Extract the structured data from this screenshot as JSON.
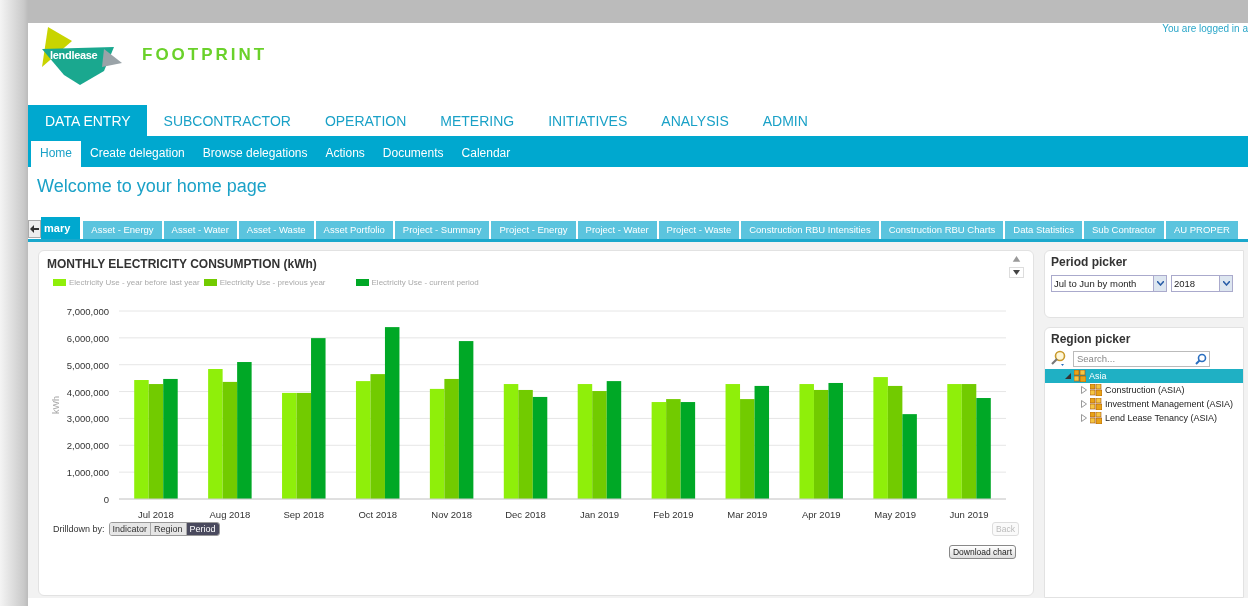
{
  "header": {
    "logo_text": "lendlease",
    "product": "FOOTPRINT",
    "login_text": "You are logged in a"
  },
  "main_nav": [
    {
      "label": "DATA ENTRY",
      "selected": true
    },
    {
      "label": "SUBCONTRACTOR",
      "selected": false
    },
    {
      "label": "OPERATION",
      "selected": false
    },
    {
      "label": "METERING",
      "selected": false
    },
    {
      "label": "INITIATIVES",
      "selected": false
    },
    {
      "label": "ANALYSIS",
      "selected": false
    },
    {
      "label": "ADMIN",
      "selected": false
    }
  ],
  "sub_nav": [
    {
      "label": "Home",
      "selected": true
    },
    {
      "label": "Create delegation",
      "selected": false
    },
    {
      "label": "Browse delegations",
      "selected": false
    },
    {
      "label": "Actions",
      "selected": false
    },
    {
      "label": "Documents",
      "selected": false
    },
    {
      "label": "Calendar",
      "selected": false
    }
  ],
  "page_title": "Welcome to your home page",
  "dashboard_tabs": [
    {
      "label": "mary",
      "selected": true
    },
    {
      "label": "Asset - Energy",
      "selected": false
    },
    {
      "label": "Asset - Water",
      "selected": false
    },
    {
      "label": "Asset - Waste",
      "selected": false
    },
    {
      "label": "Asset Portfolio",
      "selected": false
    },
    {
      "label": "Project - Summary",
      "selected": false
    },
    {
      "label": "Project - Energy",
      "selected": false
    },
    {
      "label": "Project - Water",
      "selected": false
    },
    {
      "label": "Project - Waste",
      "selected": false
    },
    {
      "label": "Construction RBU Intensities",
      "selected": false
    },
    {
      "label": "Construction RBU Charts",
      "selected": false
    },
    {
      "label": "Data Statistics",
      "selected": false
    },
    {
      "label": "Sub Contractor",
      "selected": false
    },
    {
      "label": "AU PROPER",
      "selected": false
    }
  ],
  "chart_panel": {
    "title": "MONTHLY ELECTRICITY CONSUMPTION (kWh)",
    "chart_data": {
      "type": "bar",
      "ylabel": "kWh",
      "grid": true,
      "legend": true,
      "categories": [
        "Jul 2018",
        "Aug 2018",
        "Sep 2018",
        "Oct 2018",
        "Nov 2018",
        "Dec 2018",
        "Jan 2019",
        "Feb 2019",
        "Mar 2019",
        "Apr 2019",
        "May 2019",
        "Jun 2019"
      ],
      "ylim": [
        0,
        7000000
      ],
      "yticks": [
        {
          "value": 0,
          "label": "0"
        },
        {
          "value": 1000000,
          "label": "1,000,000"
        },
        {
          "value": 2000000,
          "label": "2,000,000"
        },
        {
          "value": 3000000,
          "label": "3,000,000"
        },
        {
          "value": 4000000,
          "label": "4,000,000"
        },
        {
          "value": 5000000,
          "label": "5,000,000"
        },
        {
          "value": 6000000,
          "label": "6,000,000"
        },
        {
          "value": 7000000,
          "label": "7,000,000"
        }
      ],
      "series": [
        {
          "name": "Electricity Use - year before last year",
          "color": "#8fef0a",
          "values": [
            4430000,
            4840000,
            3950000,
            4390000,
            4100000,
            4280000,
            4280000,
            3610000,
            4280000,
            4280000,
            4540000,
            4280000
          ]
        },
        {
          "name": "Electricity Use - previous year",
          "color": "#72cb00",
          "values": [
            4280000,
            4360000,
            3950000,
            4650000,
            4470000,
            4060000,
            4020000,
            3720000,
            3720000,
            4060000,
            4210000,
            4280000
          ]
        },
        {
          "name": "Electricity Use - current period",
          "color": "#00a826",
          "values": [
            4470000,
            5100000,
            5990000,
            6400000,
            5880000,
            3800000,
            4390000,
            3610000,
            4210000,
            4320000,
            3160000,
            3760000
          ]
        }
      ]
    },
    "drilldown_label": "Drilldown by:",
    "drilldown_options": [
      {
        "label": "Indicator",
        "selected": false
      },
      {
        "label": "Region",
        "selected": false
      },
      {
        "label": "Period",
        "selected": true
      }
    ],
    "back_button": {
      "label": "Back",
      "disabled": true
    },
    "download_button": "Download chart"
  },
  "period_picker": {
    "title": "Period picker",
    "period": "Jul to Jun by month",
    "year": "2018"
  },
  "region_picker": {
    "title": "Region picker",
    "search_placeholder": "Search...",
    "tree": [
      {
        "label": "Asia",
        "selected": true,
        "expanded": true,
        "children": [
          {
            "label": "Construction (ASIA)",
            "selected": false,
            "expanded": false
          },
          {
            "label": "Investment Management (ASIA)",
            "selected": false,
            "expanded": false
          },
          {
            "label": "Lend Lease Tenancy (ASIA)",
            "selected": false,
            "expanded": false
          }
        ]
      }
    ]
  }
}
